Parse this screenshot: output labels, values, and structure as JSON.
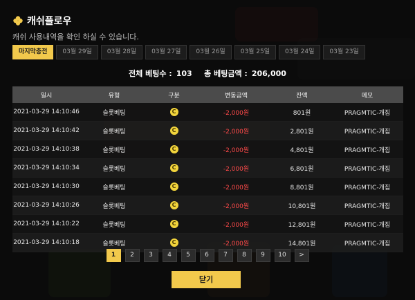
{
  "header": {
    "title": "캐쉬플로우",
    "subtitle": "캐쉬 사용내역을 확인 하실 수 있습니다."
  },
  "tabs": [
    {
      "label": "마지막충전",
      "active": true
    },
    {
      "label": "03월 29일"
    },
    {
      "label": "03월 28일"
    },
    {
      "label": "03월 27일"
    },
    {
      "label": "03월 26일"
    },
    {
      "label": "03월 25일"
    },
    {
      "label": "03월 24일"
    },
    {
      "label": "03월 23일"
    }
  ],
  "summary": {
    "total_label": "전체 베팅수 :",
    "total_value": "103",
    "amount_label": "총 베팅금액 :",
    "amount_value": "206,000"
  },
  "table": {
    "headers": [
      "일시",
      "유형",
      "구분",
      "변동금액",
      "잔액",
      "메모"
    ],
    "rows": [
      [
        "2021-03-29 14:10:46",
        "슬롯베팅",
        "C",
        "-2,000원",
        "801원",
        "PRAGMTIC-개집"
      ],
      [
        "2021-03-29 14:10:42",
        "슬롯베팅",
        "C",
        "-2,000원",
        "2,801원",
        "PRAGMTIC-개집"
      ],
      [
        "2021-03-29 14:10:38",
        "슬롯베팅",
        "C",
        "-2,000원",
        "4,801원",
        "PRAGMTIC-개집"
      ],
      [
        "2021-03-29 14:10:34",
        "슬롯베팅",
        "C",
        "-2,000원",
        "6,801원",
        "PRAGMTIC-개집"
      ],
      [
        "2021-03-29 14:10:30",
        "슬롯베팅",
        "C",
        "-2,000원",
        "8,801원",
        "PRAGMTIC-개집"
      ],
      [
        "2021-03-29 14:10:26",
        "슬롯베팅",
        "C",
        "-2,000원",
        "10,801원",
        "PRAGMTIC-개집"
      ],
      [
        "2021-03-29 14:10:22",
        "슬롯베팅",
        "C",
        "-2,000원",
        "12,801원",
        "PRAGMTIC-개집"
      ],
      [
        "2021-03-29 14:10:18",
        "슬롯베팅",
        "C",
        "-2,000원",
        "14,801원",
        "PRAGMTIC-개집"
      ]
    ]
  },
  "pagination": {
    "pages": [
      "1",
      "2",
      "3",
      "4",
      "5",
      "6",
      "7",
      "8",
      "9",
      "10"
    ],
    "active": "1",
    "next": ">"
  },
  "close_button": "닫기",
  "colors": {
    "accent": "#f2c94c",
    "negative": "#ff4a4a",
    "header_bg": "#4b4b4b"
  },
  "icons": {
    "title": "clover-icon",
    "coin": "coin-icon"
  }
}
